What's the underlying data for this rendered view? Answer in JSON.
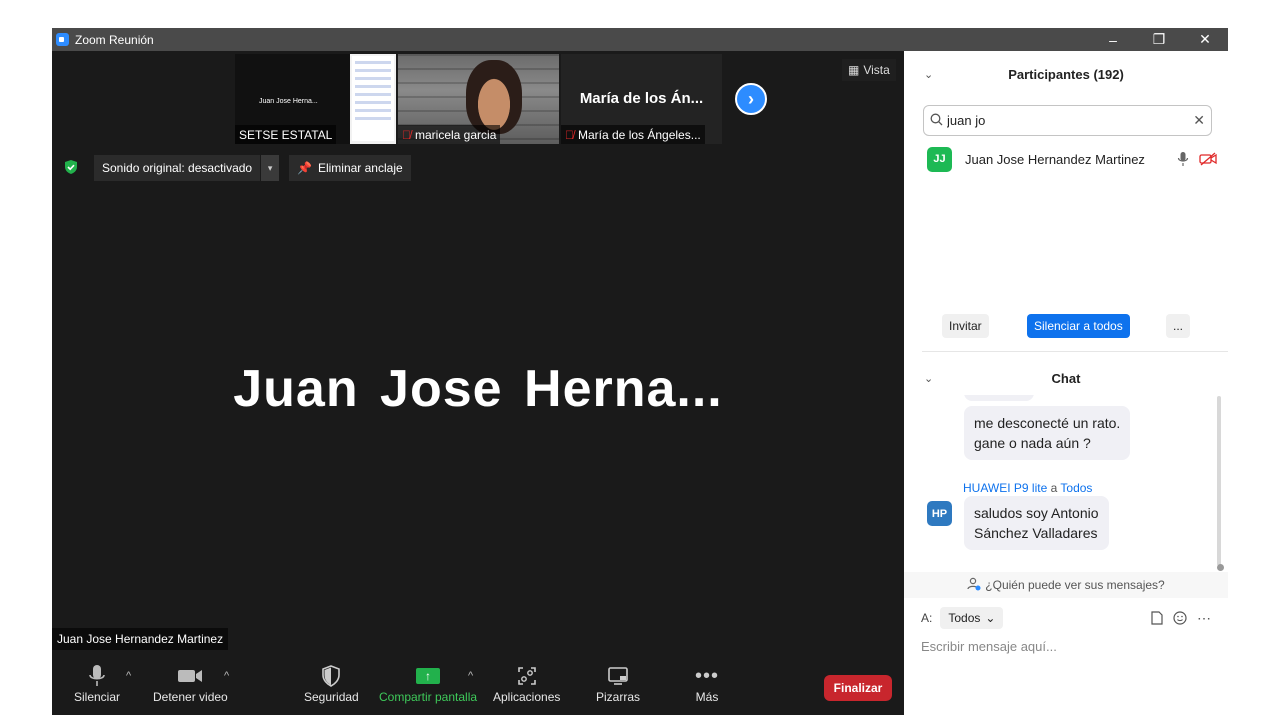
{
  "window": {
    "title": "Zoom Reunión",
    "controls": [
      "–",
      "❐",
      "✕"
    ]
  },
  "thumbnails": [
    {
      "label": "SETSE ESTATAL",
      "screen_text": "Juan Jose Herna...",
      "muted": false
    },
    {
      "label": "maricela garcia",
      "muted": true
    },
    {
      "label": "María de los Ángeles...",
      "big_name": "María de los Án...",
      "muted": true
    }
  ],
  "view_button": "Vista",
  "sound_control": {
    "label": "Sonido original: desactivado",
    "dropdown": "▾"
  },
  "unpin_button": "Eliminar anclaje",
  "active_speaker": {
    "big_name": "Juan Jose Herna...",
    "label": "Juan Jose Hernandez Martinez"
  },
  "toolbar": {
    "mute": "Silenciar",
    "stop_video": "Detener video",
    "security": "Seguridad",
    "share_screen": "Compartir pantalla",
    "apps": "Aplicaciones",
    "whiteboards": "Pizarras",
    "more": "Más",
    "end": "Finalizar",
    "caret": "^"
  },
  "participants": {
    "title": "Participantes (192)",
    "search_value": "juan jo",
    "list": [
      {
        "initials": "JJ",
        "name": "Juan Jose Hernandez Martinez",
        "avatar_color": "#1db954"
      }
    ],
    "buttons": {
      "invite": "Invitar",
      "mute_all": "Silenciar a todos",
      "more": "..."
    }
  },
  "chat": {
    "title": "Chat",
    "messages": [
      {
        "text_line1": "me desconecté un rato.",
        "text_line2": "gane o nada aún ?"
      },
      {
        "sender": "HUAWEI P9 lite",
        "connector": "a",
        "recipient": "Todos",
        "initials": "HP",
        "avatar_color": "#2e79c0",
        "text_line1": "saludos soy Antonio",
        "text_line2": "Sánchez Valladares"
      }
    ],
    "privacy_text": "¿Quién puede ver sus mensajes?",
    "to_label": "A:",
    "to_value": "Todos",
    "input_placeholder": "Escribir mensaje aquí..."
  },
  "colors": {
    "accent": "#0e72ed",
    "end_button": "#c8262d",
    "share_green": "#22b14c"
  }
}
